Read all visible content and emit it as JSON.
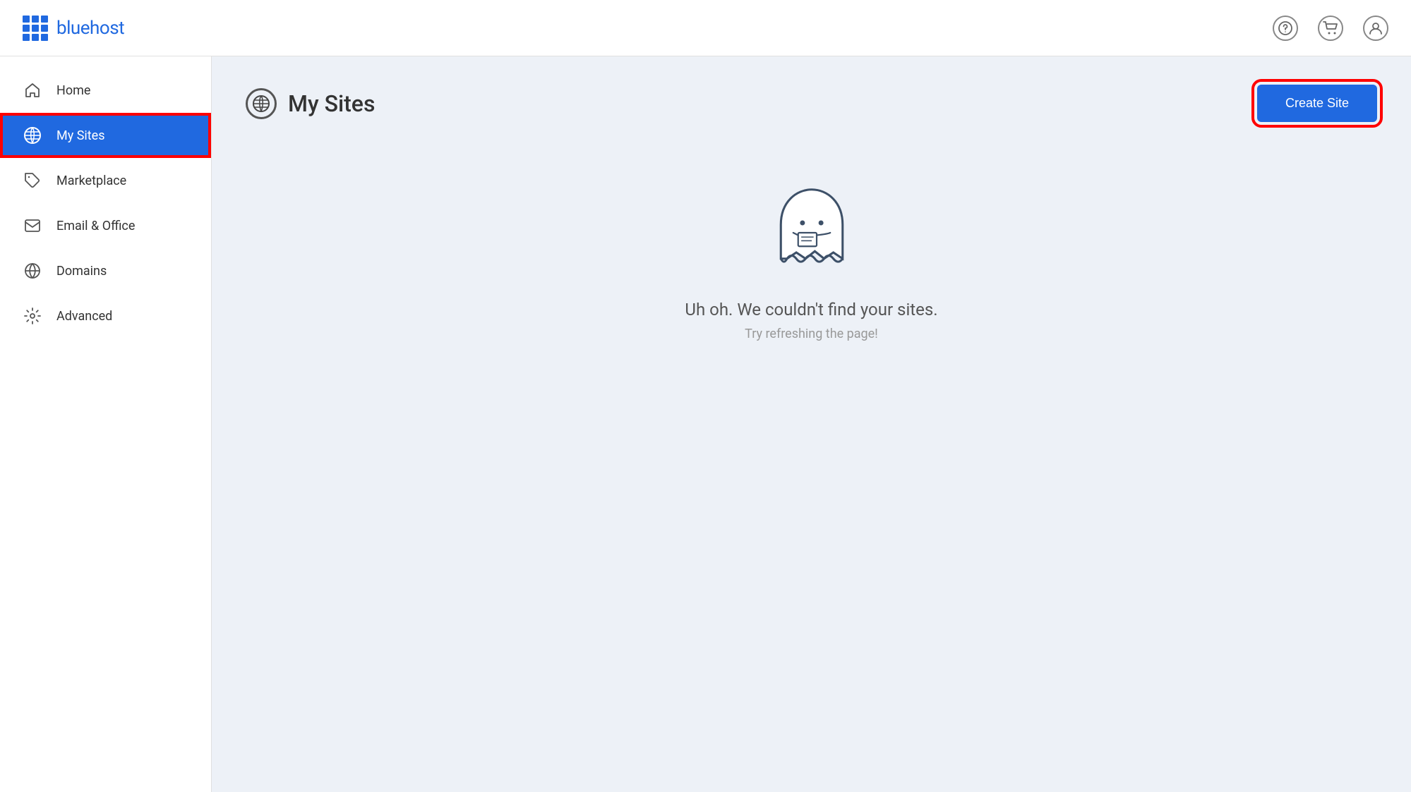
{
  "header": {
    "logo_text": "bluehost",
    "icons": {
      "help": "?",
      "cart": "cart-icon",
      "user": "user-icon"
    }
  },
  "sidebar": {
    "items": [
      {
        "id": "home",
        "label": "Home",
        "icon": "home-icon",
        "active": false
      },
      {
        "id": "my-sites",
        "label": "My Sites",
        "icon": "wordpress-icon",
        "active": true
      },
      {
        "id": "marketplace",
        "label": "Marketplace",
        "icon": "tag-icon",
        "active": false
      },
      {
        "id": "email-office",
        "label": "Email & Office",
        "icon": "email-icon",
        "active": false
      },
      {
        "id": "domains",
        "label": "Domains",
        "icon": "domains-icon",
        "active": false
      },
      {
        "id": "advanced",
        "label": "Advanced",
        "icon": "advanced-icon",
        "active": false
      }
    ]
  },
  "main": {
    "page_title": "My Sites",
    "create_site_btn": "Create Site"
  },
  "empty_state": {
    "title": "Uh oh. We couldn't find your sites.",
    "subtitle": "Try refreshing the page!"
  }
}
